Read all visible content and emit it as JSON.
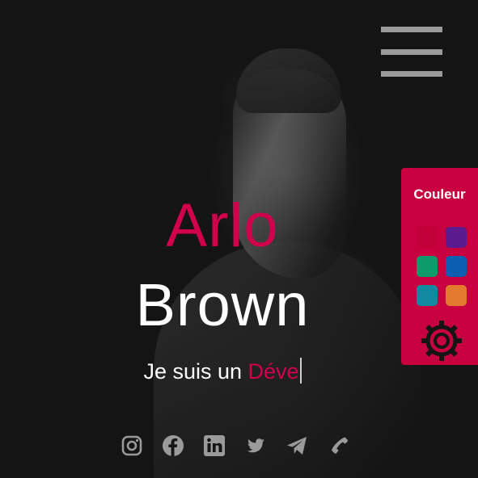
{
  "menu": {
    "icon": "hamburger-icon"
  },
  "hero": {
    "first_name": "Arlo",
    "last_name": "Brown",
    "tagline_prefix": "Je suis un ",
    "tagline_typed": "Déve"
  },
  "colors": {
    "accent": "#d1004b",
    "panel_bg": "#c8003f",
    "background": "#151515",
    "icon_gray": "#9a9a9a"
  },
  "color_panel": {
    "title": "Couleur",
    "swatches": [
      {
        "name": "crimson",
        "color": "#c2003a"
      },
      {
        "name": "purple",
        "color": "#5b1a8e"
      },
      {
        "name": "green",
        "color": "#0e9b6c"
      },
      {
        "name": "blue",
        "color": "#0c5fb0"
      },
      {
        "name": "teal",
        "color": "#1189a0"
      },
      {
        "name": "orange",
        "color": "#e27b2f"
      }
    ],
    "settings_icon": "gear-icon"
  },
  "socials": [
    {
      "name": "instagram",
      "icon": "instagram-icon"
    },
    {
      "name": "facebook",
      "icon": "facebook-icon"
    },
    {
      "name": "linkedin",
      "icon": "linkedin-icon"
    },
    {
      "name": "twitter",
      "icon": "twitter-icon"
    },
    {
      "name": "telegram",
      "icon": "telegram-icon"
    },
    {
      "name": "phone",
      "icon": "phone-icon"
    }
  ]
}
